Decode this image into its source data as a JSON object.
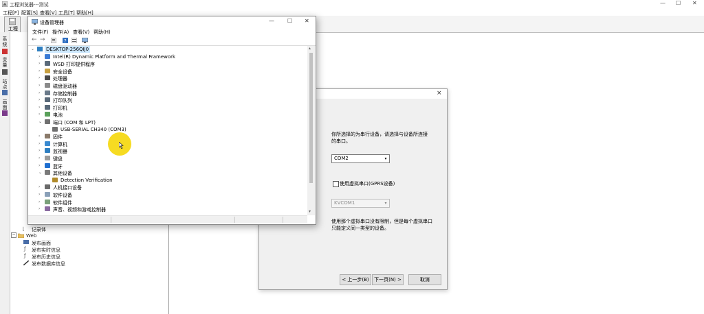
{
  "app": {
    "title": "工程浏览器---测试",
    "menu": [
      "工程[F]",
      "配置[S]",
      "查看[V]",
      "工具[T]",
      "帮助[H]"
    ],
    "toolbar": {
      "project_label": "工程"
    },
    "vertical_tabs": [
      "系统",
      "变量",
      "站点",
      "画面"
    ],
    "tree": {
      "recipe_label": "记录体",
      "web_label": "Web",
      "web_items": [
        "发布画面",
        "发布实时信息",
        "发布历史信息",
        "发布数据库信息"
      ]
    }
  },
  "device_manager": {
    "title": "设备管理器",
    "menu": [
      "文件(F)",
      "操作(A)",
      "查看(V)",
      "帮助(H)"
    ],
    "computer": "DESKTOP-256QIJ0",
    "nodes": [
      {
        "label": "Intel(R) Dynamic Platform and Thermal Framework",
        "caret": "›",
        "icon": "chip-icon",
        "level": 1
      },
      {
        "label": "WSD 打印提供程序",
        "caret": "›",
        "icon": "printer-icon",
        "level": 1
      },
      {
        "label": "安全设备",
        "caret": "›",
        "icon": "security-icon",
        "level": 1
      },
      {
        "label": "处理器",
        "caret": "›",
        "icon": "processor-icon",
        "level": 1
      },
      {
        "label": "磁盘驱动器",
        "caret": "›",
        "icon": "disk-icon",
        "level": 1
      },
      {
        "label": "存储控制器",
        "caret": "›",
        "icon": "storage-icon",
        "level": 1
      },
      {
        "label": "打印队列",
        "caret": "›",
        "icon": "printer-icon",
        "level": 1
      },
      {
        "label": "打印机",
        "caret": "›",
        "icon": "printer-icon",
        "level": 1
      },
      {
        "label": "电池",
        "caret": "›",
        "icon": "battery-icon",
        "level": 1
      },
      {
        "label": "端口 (COM 和 LPT)",
        "caret": "⌄",
        "icon": "port-icon",
        "level": 1
      },
      {
        "label": "USB-SERIAL CH340 (COM3)",
        "caret": "",
        "icon": "port-icon",
        "level": 2
      },
      {
        "label": "固件",
        "caret": "›",
        "icon": "firmware-icon",
        "level": 1
      },
      {
        "label": "计算机",
        "caret": "›",
        "icon": "computer-icon",
        "level": 1
      },
      {
        "label": "监视器",
        "caret": "›",
        "icon": "monitor-icon",
        "level": 1
      },
      {
        "label": "键盘",
        "caret": "›",
        "icon": "keyboard-icon",
        "level": 1
      },
      {
        "label": "蓝牙",
        "caret": "›",
        "icon": "bluetooth-icon",
        "level": 1
      },
      {
        "label": "其他设备",
        "caret": "⌄",
        "icon": "unknown-device-icon",
        "level": 1
      },
      {
        "label": "Detection Verification",
        "caret": "",
        "icon": "warning-device-icon",
        "level": 2
      },
      {
        "label": "人机接口设备",
        "caret": "›",
        "icon": "hid-icon",
        "level": 1
      },
      {
        "label": "软件设备",
        "caret": "›",
        "icon": "software-device-icon",
        "level": 1
      },
      {
        "label": "软件组件",
        "caret": "›",
        "icon": "software-component-icon",
        "level": 1
      },
      {
        "label": "声音、视频和游戏控制器",
        "caret": "›",
        "icon": "sound-icon",
        "level": 1
      }
    ]
  },
  "wizard": {
    "instruction": "你所选择的为串行设备，请选择与设备所连接的串口。",
    "port_value": "COM2",
    "virtual_checkbox_label": "使用虚拟串口(GPRS设备)",
    "virtual_value": "KVCOM1",
    "note": "使用那个虚拟串口没有限制，但是每个虚拟串口只能定义同一类型的设备。",
    "back_label": "< 上一步(B)",
    "next_label": "下一页(N) >",
    "cancel_label": "取消",
    "close_glyph": "×"
  },
  "window_controls": {
    "minimize": "—",
    "maximize": "☐",
    "close": "✕"
  },
  "colors": {
    "selection": "#cce8ff",
    "highlight": "#f5d80f",
    "folder": "#e8c060",
    "monitor_blue": "#2f7fc1"
  }
}
